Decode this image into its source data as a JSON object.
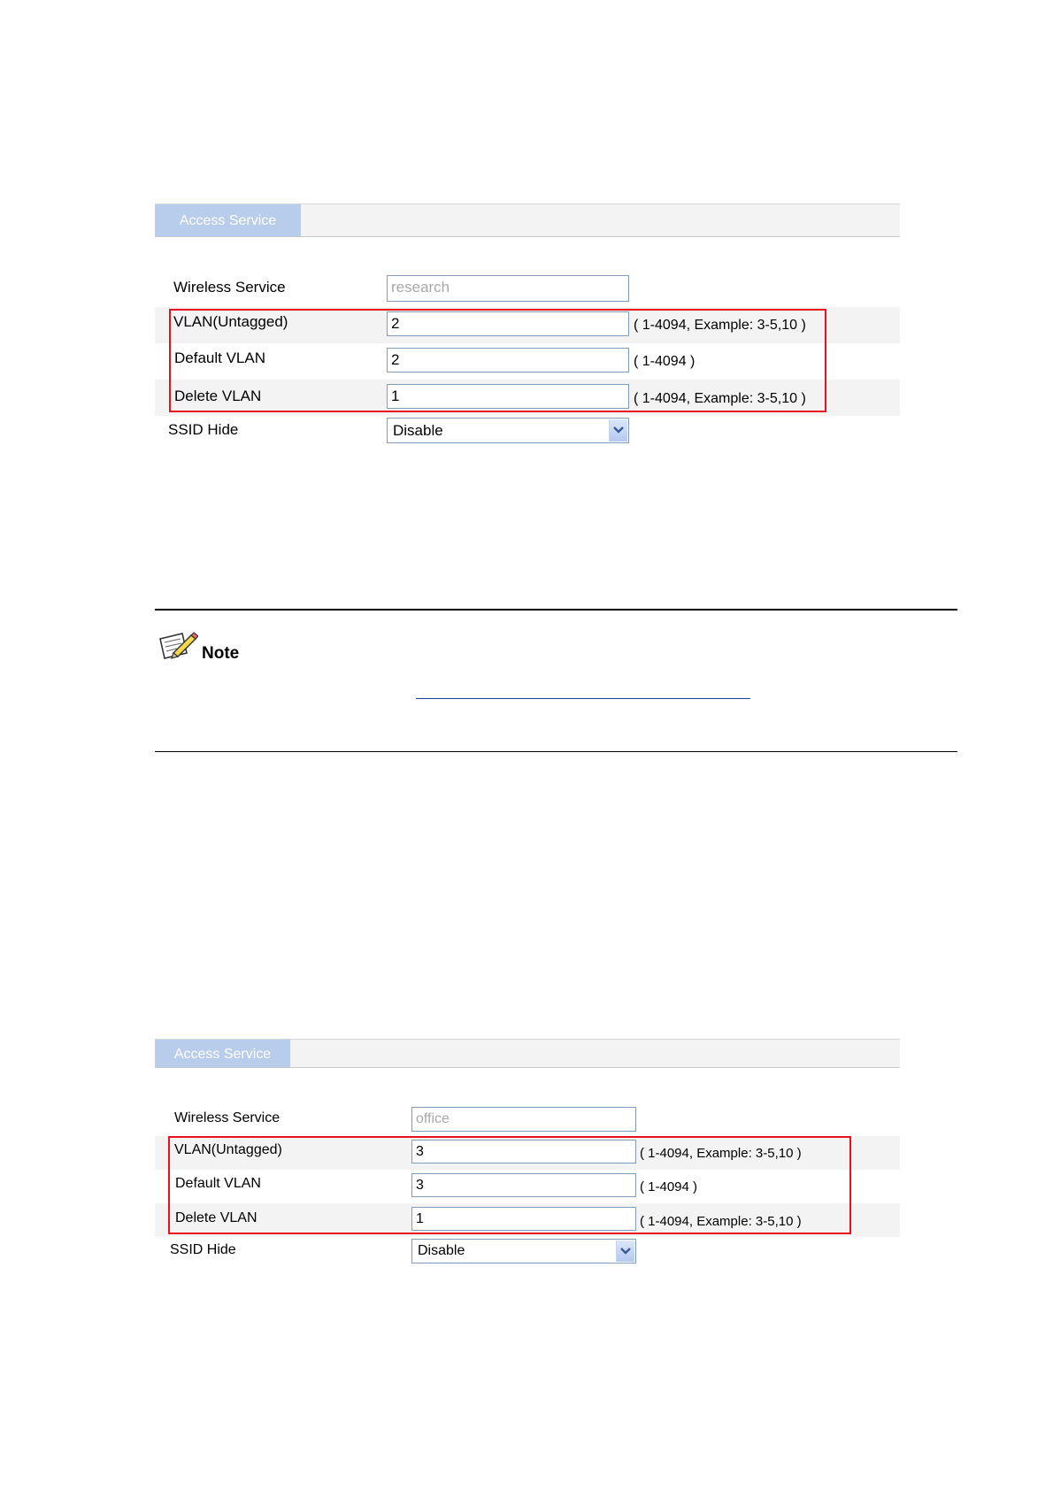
{
  "panel1": {
    "tab_label": "Access Service",
    "wireless_service_label": "Wireless Service",
    "wireless_service_value": "research",
    "vlan_untagged_label": "VLAN(Untagged)",
    "vlan_untagged_value": "2",
    "vlan_untagged_hint": "( 1-4094, Example: 3-5,10 )",
    "default_vlan_label": "Default VLAN",
    "default_vlan_value": "2",
    "default_vlan_hint": "( 1-4094 )",
    "delete_vlan_label": "Delete VLAN",
    "delete_vlan_value": "1",
    "delete_vlan_hint": "( 1-4094, Example: 3-5,10 )",
    "ssid_hide_label": "SSID Hide",
    "ssid_hide_value": "Disable"
  },
  "note": {
    "label": "Note"
  },
  "panel2": {
    "tab_label": "Access Service",
    "wireless_service_label": "Wireless Service",
    "wireless_service_value": "office",
    "vlan_untagged_label": "VLAN(Untagged)",
    "vlan_untagged_value": "3",
    "vlan_untagged_hint": "( 1-4094, Example: 3-5,10 )",
    "default_vlan_label": "Default VLAN",
    "default_vlan_value": "3",
    "default_vlan_hint": "( 1-4094 )",
    "delete_vlan_label": "Delete VLAN",
    "delete_vlan_value": "1",
    "delete_vlan_hint": "( 1-4094, Example: 3-5,10 )",
    "ssid_hide_label": "SSID Hide",
    "ssid_hide_value": "Disable"
  },
  "colors": {
    "highlight": "#e8121f",
    "tab": "#b8ccec",
    "input_border": "#7f9db9"
  },
  "icons": [
    "note-pencil-icon",
    "chevron-down-icon"
  ]
}
